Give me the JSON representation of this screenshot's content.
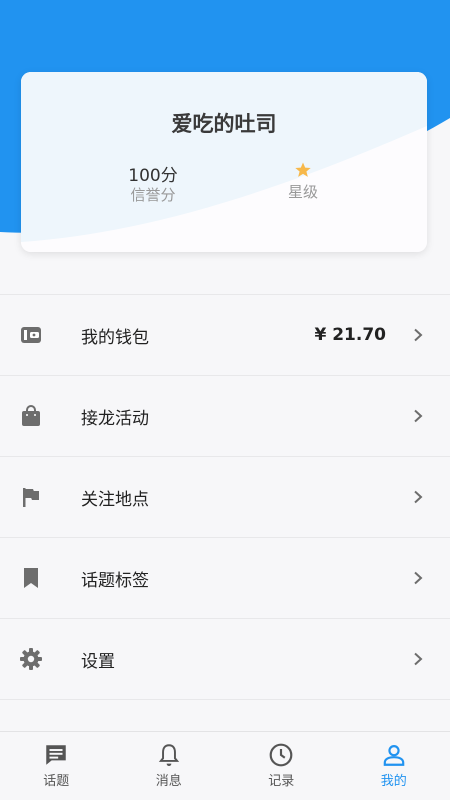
{
  "colors": {
    "accent": "#2193f0",
    "star": "#f7b84a",
    "icon_gray": "#6d6d6d"
  },
  "profile": {
    "username": "爱吃的吐司",
    "credit_value": "100分",
    "credit_label": "信誉分",
    "rating_label": "星级",
    "rating_icon": "star-icon"
  },
  "menu": {
    "items": [
      {
        "icon": "wallet-icon",
        "label": "我的钱包",
        "value": "¥ 21.70"
      },
      {
        "icon": "shopping-bag-icon",
        "label": "接龙活动"
      },
      {
        "icon": "flag-icon",
        "label": "关注地点"
      },
      {
        "icon": "bookmark-icon",
        "label": "话题标签"
      },
      {
        "icon": "gear-icon",
        "label": "设置"
      }
    ]
  },
  "tabbar": {
    "active": "我的",
    "tabs": [
      {
        "icon": "chat-icon",
        "label": "话题"
      },
      {
        "icon": "bell-icon",
        "label": "消息"
      },
      {
        "icon": "clock-icon",
        "label": "记录"
      },
      {
        "icon": "user-icon",
        "label": "我的"
      }
    ]
  }
}
